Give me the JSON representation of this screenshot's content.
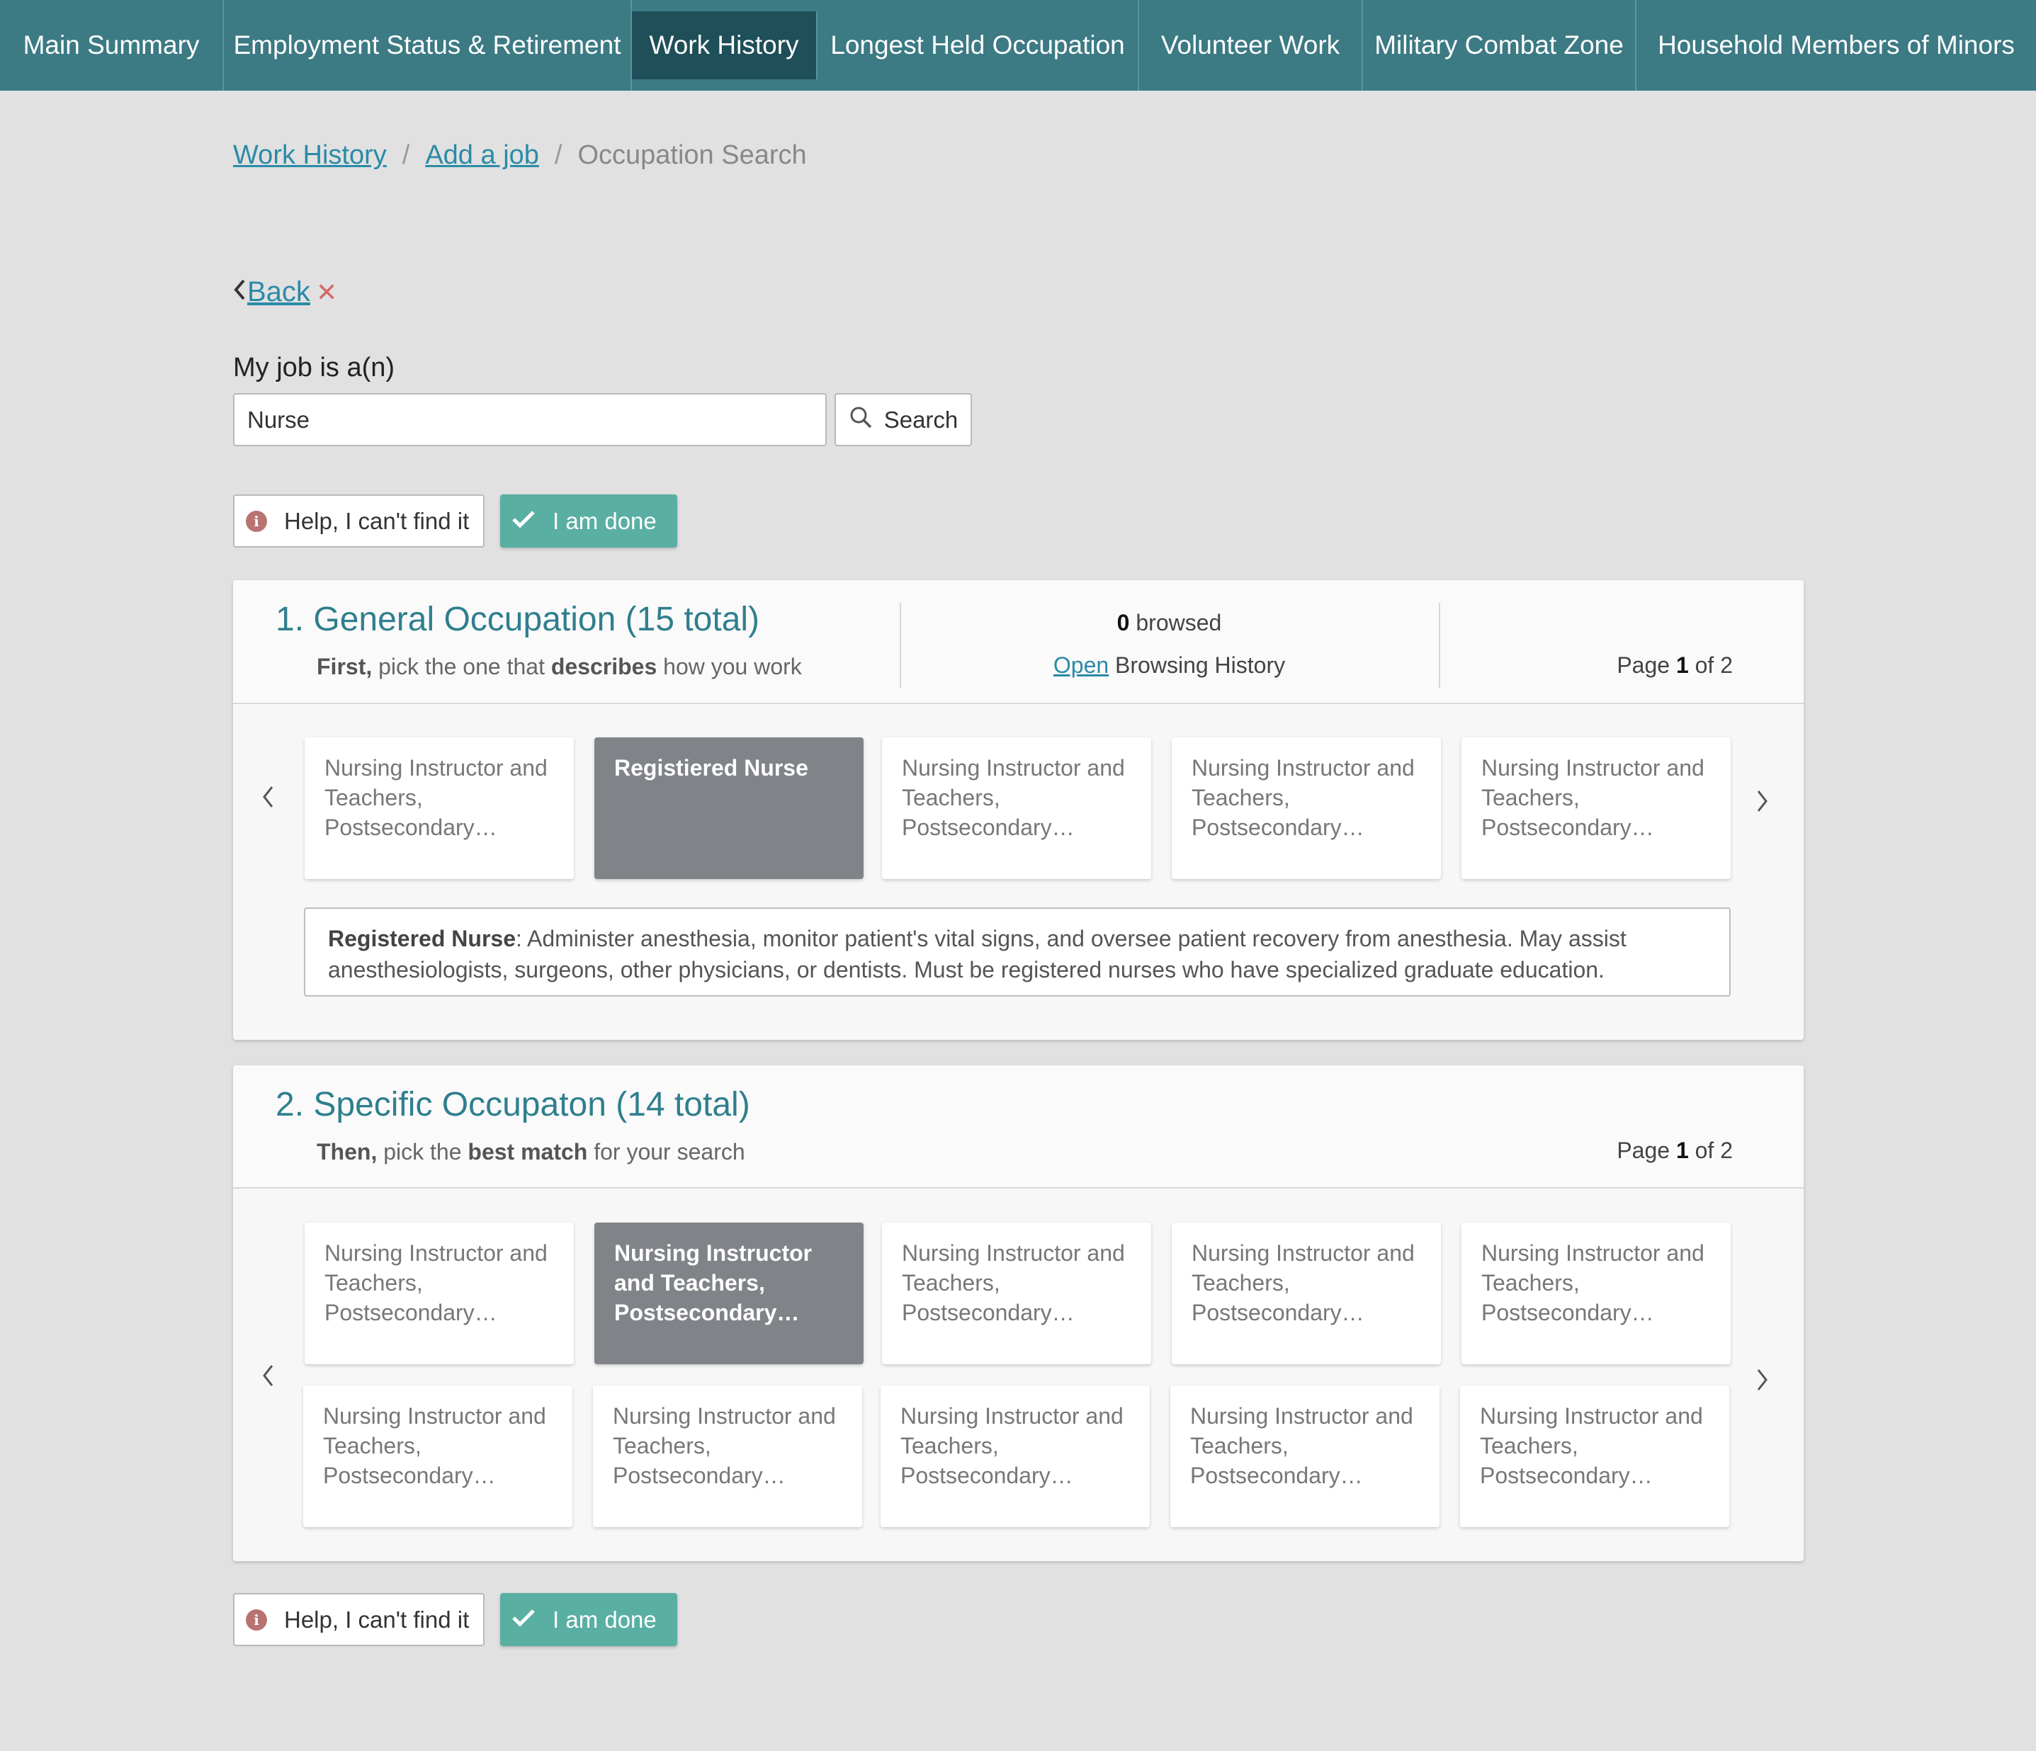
{
  "nav": {
    "tabs": [
      {
        "label": "Main Summary"
      },
      {
        "label": "Employment Status & Retirement"
      },
      {
        "label": "Work History",
        "active": true
      },
      {
        "label": "Longest Held Occupation"
      },
      {
        "label": "Volunteer Work"
      },
      {
        "label": "Military Combat Zone"
      },
      {
        "label": "Household Members of Minors"
      }
    ]
  },
  "breadcrumb": {
    "items": [
      "Work History",
      "Add a job"
    ],
    "current": "Occupation Search",
    "separator": "/"
  },
  "back": {
    "label": "Back"
  },
  "search": {
    "label": "My job is a(n)",
    "value": "Nurse",
    "button_label": "Search"
  },
  "actions": {
    "help_label": "Help, I can't find it",
    "done_label": "I am done"
  },
  "general": {
    "title": "1. General Occupation (15 total)",
    "sub_first": "First,",
    "sub_mid": " pick the one that ",
    "sub_bold": "describes",
    "sub_end": " how you work",
    "browsed_count": "0",
    "browsed_label": " browsed",
    "open_label": "Open",
    "history_label": " Browsing History",
    "page_label": "Page ",
    "page_current": "1",
    "page_of": " of  2",
    "cards": [
      "Nursing Instructor and Teachers, Postsecondary…",
      "Registiered Nurse",
      "Nursing Instructor and Teachers, Postsecondary…",
      "Nursing Instructor and Teachers, Postsecondary…",
      "Nursing Instructor and Teachers, Postsecondary…"
    ],
    "selected_index": 1,
    "description_term": "Registered Nurse",
    "description_text": ": Administer anesthesia, monitor patient's vital signs, and oversee patient recovery from anesthesia. May assist anesthesiologists, surgeons, other physicians, or dentists. Must be registered nurses who have specialized graduate education."
  },
  "specific": {
    "title": "2. Specific Occupaton (14 total)",
    "sub_first": "Then,",
    "sub_mid": " pick the ",
    "sub_bold": "best match",
    "sub_end": " for your search",
    "page_label": "Page ",
    "page_current": "1",
    "page_of": " of  2",
    "cards": [
      "Nursing Instructor and Teachers, Postsecondary…",
      "Nursing Instructor and Teachers, Postsecondary…",
      "Nursing Instructor and Teachers, Postsecondary…",
      "Nursing Instructor and Teachers, Postsecondary…",
      "Nursing Instructor and Teachers, Postsecondary…",
      "Nursing Instructor and Teachers, Postsecondary…",
      "Nursing Instructor and Teachers, Postsecondary…",
      "Nursing Instructor and Teachers, Postsecondary…",
      "Nursing Instructor and Teachers, Postsecondary…",
      "Nursing Instructor and Teachers, Postsecondary…"
    ],
    "selected_index": 1
  },
  "colors": {
    "nav_bg": "#3c7a84",
    "nav_active": "#1f4f58",
    "accent": "#2f7f8e",
    "link": "#2a8ba8",
    "done": "#5aafa3",
    "selected_card": "#808387"
  }
}
